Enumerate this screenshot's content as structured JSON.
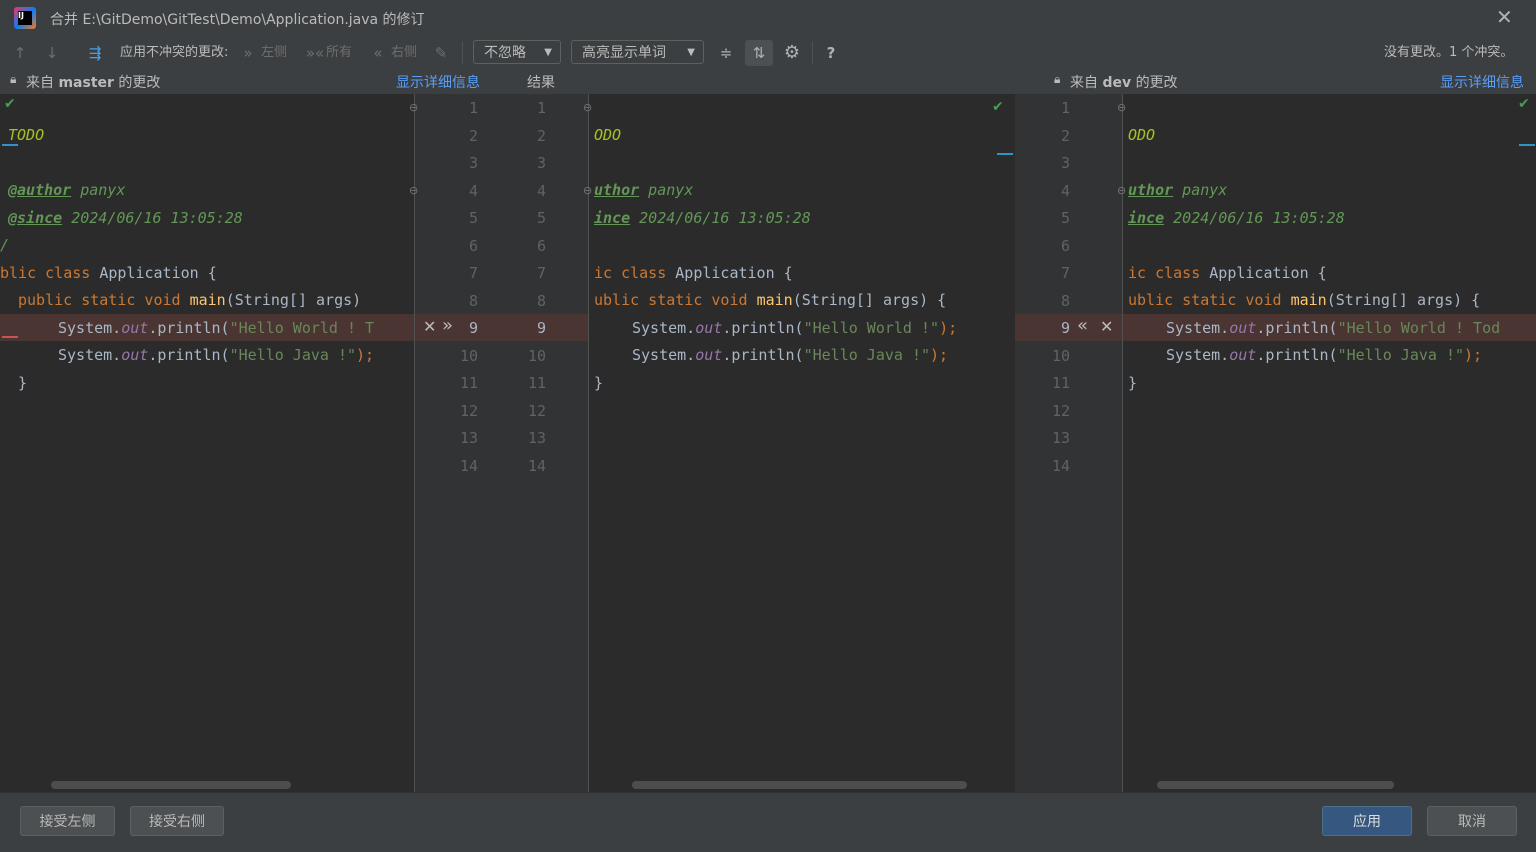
{
  "window": {
    "title": "合并 E:\\GitDemo\\GitTest\\Demo\\Application.java 的修订"
  },
  "toolbar": {
    "apply_nonconflicting_label": "应用不冲突的更改:",
    "left_label": "左侧",
    "all_label": "所有",
    "right_label": "右侧",
    "ignore_dropdown": "不忽略",
    "highlight_dropdown": "高亮显示单词",
    "help_label": "?",
    "status": "没有更改。1 个冲突。"
  },
  "panes": {
    "left_header_prefix": "来自",
    "left_branch": "master",
    "left_header_suffix": "的更改",
    "show_details": "显示详细信息",
    "result_header": "结果",
    "right_header_prefix": "来自",
    "right_branch": "dev",
    "right_header_suffix": "的更改",
    "show_details_right": "显示详细信息"
  },
  "line_numbers": [
    "1",
    "2",
    "3",
    "4",
    "5",
    "6",
    "7",
    "8",
    "9",
    "10",
    "11",
    "12",
    "13",
    "14"
  ],
  "code": {
    "left": {
      "l2": "TODO",
      "l4_tag": "@author",
      "l4_rest": " panyx",
      "l5_tag": "@since",
      "l5_rest": " 2024/06/16 13:05:28",
      "l6": "/",
      "l7_kw": "blic class",
      "l7_rest": " Application {",
      "l8_kw": "public static void",
      "l8_fn": "main",
      "l8_rest": "(String[] args)",
      "l9_a": "System.",
      "l9_fld": "out",
      "l9_b": ".println(",
      "l9_str": "\"Hello World ! T",
      "l10_a": "System.",
      "l10_fld": "out",
      "l10_b": ".println(",
      "l10_str": "\"Hello Java !\"",
      "l10_c": ");",
      "l11": "}"
    },
    "middle": {
      "l2": "ODO",
      "l4_tag": "uthor",
      "l4_rest": " panyx",
      "l5_tag": "ince",
      "l5_rest": " 2024/06/16 13:05:28",
      "l7_kw": "ic class",
      "l7_rest": " Application {",
      "l8_kw": "ublic static void",
      "l8_fn": "main",
      "l8_rest": "(String[] args) {",
      "l9_a": "System.",
      "l9_fld": "out",
      "l9_b": ".println(",
      "l9_str": "\"Hello World !\"",
      "l9_c": ");",
      "l10_a": "System.",
      "l10_fld": "out",
      "l10_b": ".println(",
      "l10_str": "\"Hello Java !\"",
      "l10_c": ");",
      "l11": "}"
    },
    "right": {
      "l2": "ODO",
      "l4_tag": "uthor",
      "l4_rest": " panyx",
      "l5_tag": "ince",
      "l5_rest": " 2024/06/16 13:05:28",
      "l7_kw": "ic class",
      "l7_rest": " Application {",
      "l8_kw": "ublic static void",
      "l8_fn": "main",
      "l8_rest": "(String[] args) {",
      "l9_a": "System.",
      "l9_fld": "out",
      "l9_b": ".println(",
      "l9_str": "\"Hello World ! Tod",
      "l10_a": "System.",
      "l10_fld": "out",
      "l10_b": ".println(",
      "l10_str": "\"Hello Java !\"",
      "l10_c": ");",
      "l11": "}"
    }
  },
  "footer": {
    "accept_left": "接受左侧",
    "accept_right": "接受右侧",
    "apply": "应用",
    "cancel": "取消"
  },
  "colors": {
    "background": "#2b2b2b",
    "panel": "#3c3f41",
    "conflict": "#4a3532",
    "link": "#589df6",
    "primary_button": "#365880"
  }
}
